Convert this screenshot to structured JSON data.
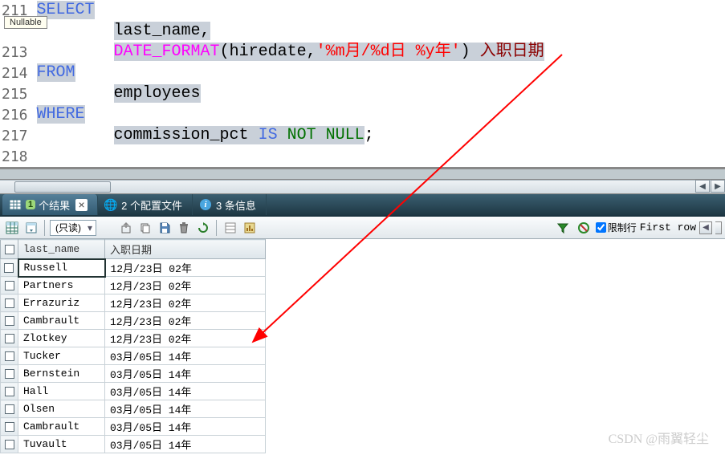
{
  "editor": {
    "tooltip": "Nullable",
    "lines": [
      {
        "num": "211",
        "tokens": [
          {
            "t": "sel",
            "v": "SELECT",
            "cls": "kw-blue"
          }
        ]
      },
      {
        "num": "",
        "tokens": [
          {
            "t": "indent",
            "v": "        "
          },
          {
            "t": "sel",
            "v": "last_name,",
            "cls": "txt-black"
          }
        ]
      },
      {
        "num": "213",
        "tokens": [
          {
            "t": "indent",
            "v": "        "
          },
          {
            "t": "sel",
            "v": "DATE_FORMAT",
            "cls": "kw-magenta"
          },
          {
            "t": "sel",
            "v": "(hiredate,",
            "cls": "txt-black"
          },
          {
            "t": "sel",
            "v": "'%m月/%d日 %y年'",
            "cls": "str-red"
          },
          {
            "t": "sel",
            "v": ") ",
            "cls": "txt-black"
          },
          {
            "t": "sel",
            "v": "入职日期",
            "cls": "str-darkred"
          }
        ]
      },
      {
        "num": "214",
        "tokens": [
          {
            "t": "sel",
            "v": "FROM",
            "cls": "kw-blue"
          }
        ]
      },
      {
        "num": "215",
        "tokens": [
          {
            "t": "indent",
            "v": "        "
          },
          {
            "t": "sel",
            "v": "employees",
            "cls": "txt-black"
          }
        ]
      },
      {
        "num": "216",
        "tokens": [
          {
            "t": "sel",
            "v": "WHERE",
            "cls": "kw-blue"
          }
        ]
      },
      {
        "num": "217",
        "tokens": [
          {
            "t": "indent",
            "v": "        "
          },
          {
            "t": "sel",
            "v": "commission_pct ",
            "cls": "txt-black"
          },
          {
            "t": "sel",
            "v": "IS",
            "cls": "kw-blue"
          },
          {
            "t": "sel",
            "v": " ",
            "cls": "txt-black"
          },
          {
            "t": "sel",
            "v": "NOT",
            "cls": "kw-green"
          },
          {
            "t": "sel",
            "v": " ",
            "cls": "txt-black"
          },
          {
            "t": "sel",
            "v": "NULL",
            "cls": "kw-green"
          },
          {
            "t": "plain",
            "v": ";",
            "cls": "txt-black"
          }
        ]
      },
      {
        "num": "218",
        "tokens": []
      }
    ]
  },
  "tabs": {
    "results_count": "1",
    "results_label": "个结果",
    "profiles_label": "2 个配置文件",
    "messages_label": "3 条信息"
  },
  "toolbar": {
    "readonly_label": "(只读)",
    "limit_label": "限制行",
    "firstrow_label": "First row"
  },
  "grid": {
    "headers": [
      "last_name",
      "入职日期"
    ],
    "rows": [
      {
        "last_name": "Russell",
        "hire": "12月/23日 02年"
      },
      {
        "last_name": "Partners",
        "hire": "12月/23日 02年"
      },
      {
        "last_name": "Errazuriz",
        "hire": "12月/23日 02年"
      },
      {
        "last_name": "Cambrault",
        "hire": "12月/23日 02年"
      },
      {
        "last_name": "Zlotkey",
        "hire": "12月/23日 02年"
      },
      {
        "last_name": "Tucker",
        "hire": "03月/05日 14年"
      },
      {
        "last_name": "Bernstein",
        "hire": "03月/05日 14年"
      },
      {
        "last_name": "Hall",
        "hire": "03月/05日 14年"
      },
      {
        "last_name": "Olsen",
        "hire": "03月/05日 14年"
      },
      {
        "last_name": "Cambrault",
        "hire": "03月/05日 14年"
      },
      {
        "last_name": "Tuvault",
        "hire": "03月/05日 14年"
      }
    ]
  },
  "watermark": "CSDN @雨翼轻尘",
  "colors": {
    "accent": "#2e5d74",
    "select_bg": "#c9d0d9"
  }
}
